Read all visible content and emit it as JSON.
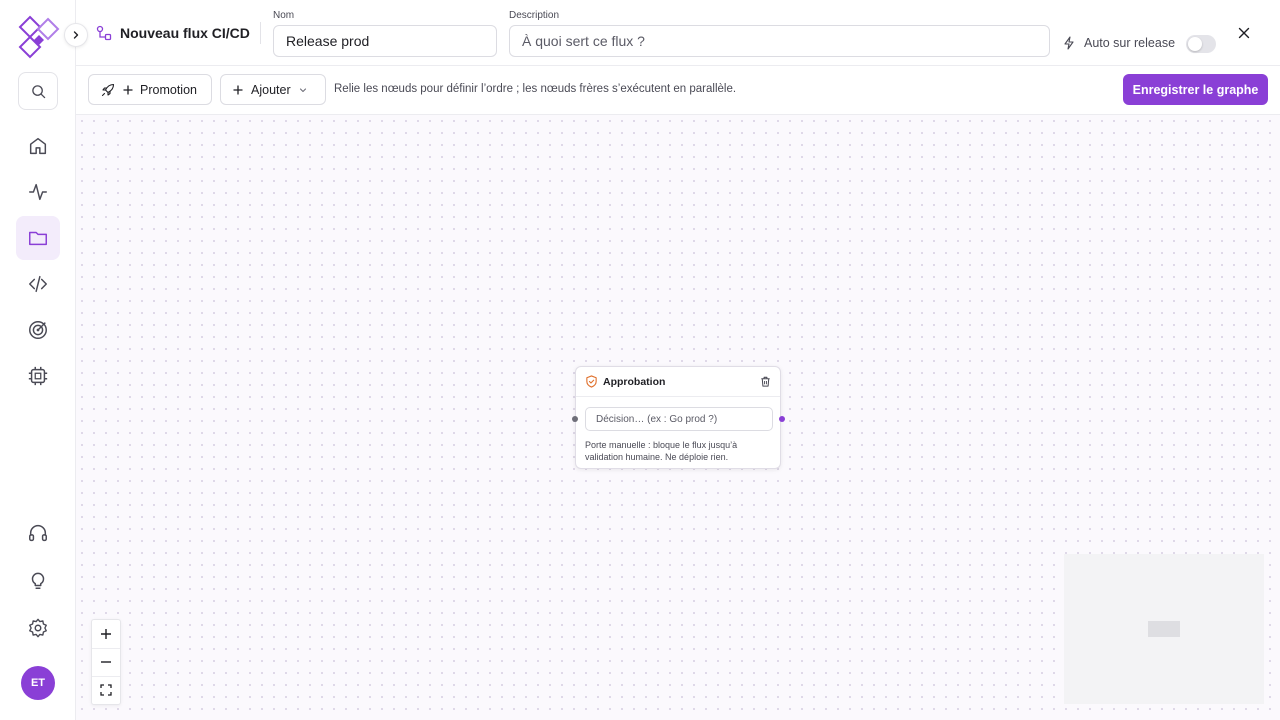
{
  "header": {
    "title": "Nouveau flux CI/CD",
    "name_label": "Nom",
    "name_value": "Release prod",
    "description_label": "Description",
    "description_placeholder": "À quoi sert ce flux ?",
    "auto_release_label": "Auto sur release",
    "auto_release_enabled": false
  },
  "toolbar": {
    "promotion_label": "Promotion",
    "add_label": "Ajouter",
    "hint": "Relie les nœuds pour définir l’ordre ; les nœuds frères s’exécutent en parallèle.",
    "save_label": "Enregistrer le graphe"
  },
  "sidebar": {
    "avatar_initials": "ET",
    "items": [
      {
        "icon": "home-icon"
      },
      {
        "icon": "activity-icon"
      },
      {
        "icon": "folder-icon",
        "active": true
      },
      {
        "icon": "code-icon"
      },
      {
        "icon": "target-icon"
      },
      {
        "icon": "chip-icon"
      },
      {
        "icon": "headset-icon"
      },
      {
        "icon": "lightbulb-icon"
      },
      {
        "icon": "gear-icon"
      }
    ]
  },
  "canvas": {
    "node": {
      "title": "Approbation",
      "input_placeholder": "Décision… (ex : Go prod ?)",
      "description": "Porte manuelle : bloque le flux jusqu’à validation humaine. Ne déploie rien."
    }
  },
  "colors": {
    "accent": "#8a3fd6",
    "node_icon": "#e0702c"
  }
}
